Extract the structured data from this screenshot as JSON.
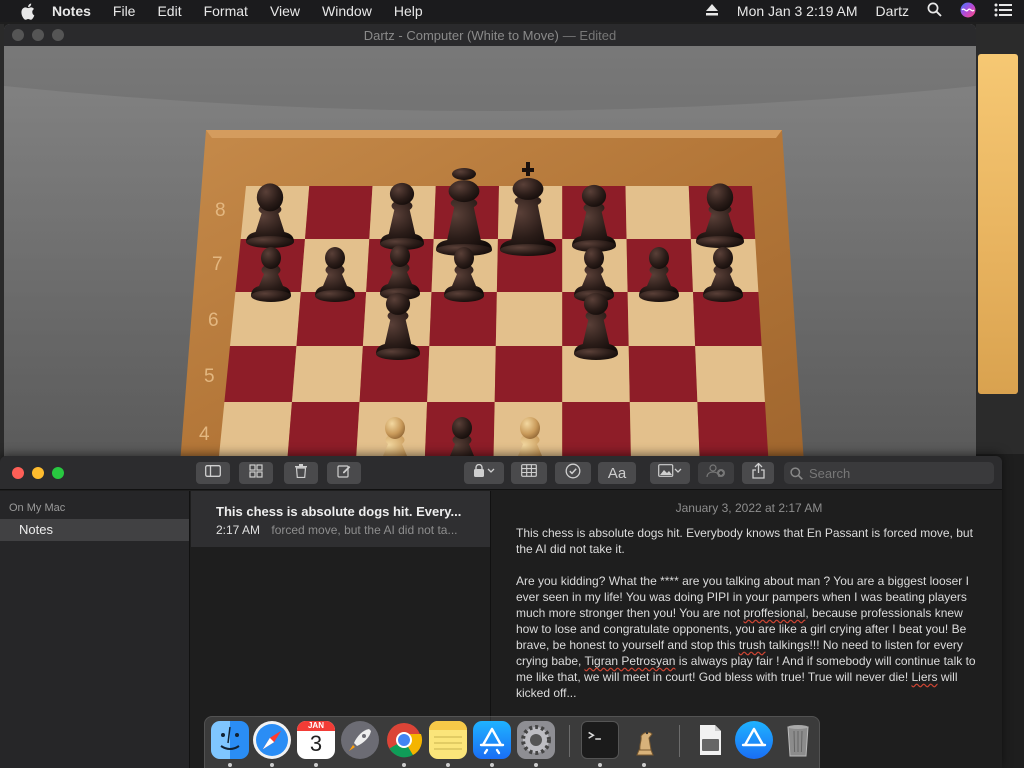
{
  "menubar": {
    "app_name": "Notes",
    "menus": [
      "File",
      "Edit",
      "Format",
      "View",
      "Window",
      "Help"
    ],
    "clock": "Mon Jan 3  2:19 AM",
    "user": "Dartz"
  },
  "chess": {
    "window_title": "Dartz - Computer   (White to Move)",
    "edited": "— Edited",
    "ranks": [
      "8",
      "7",
      "6",
      "5",
      "4"
    ]
  },
  "notes": {
    "sidebar": {
      "section": "On My Mac",
      "folder": "Notes"
    },
    "search_placeholder": "Search",
    "format_button": "Aa",
    "list": [
      {
        "title": "This chess is absolute dogs hit. Every...",
        "time": "2:17 AM",
        "preview": "forced move, but the AI did not ta..."
      }
    ],
    "editor": {
      "date": "January 3, 2022 at 2:17 AM",
      "para1": "This chess is absolute dogs hit. Everybody knows that En Passant is forced move, but the AI did not take it.",
      "p2_a": "Are you kidding? What the **** are you talking about man ? You are a biggest looser I ever seen in my life! You was doing PIPI in your pampers when I was beating players much more stronger then you! You are not ",
      "p2_typo1": "proffesional",
      "p2_b": ", because professionals knew how to lose and congratulate opponents, you are like a girl crying after I beat you! Be brave, be honest to yourself and stop this ",
      "p2_typo2": "trush",
      "p2_c": " talkings!!! No need to listen for every crying babe, ",
      "p2_typo3": "Tigran Petrosyan",
      "p2_d": " is always play fair ! And if somebody will continue talk to me like that, we will meet in court! God bless with true! True will never die! ",
      "p2_typo4": "Liers",
      "p2_e": " will kicked off..."
    }
  },
  "dock": {
    "calendar_month": "JAN",
    "calendar_day": "3"
  }
}
